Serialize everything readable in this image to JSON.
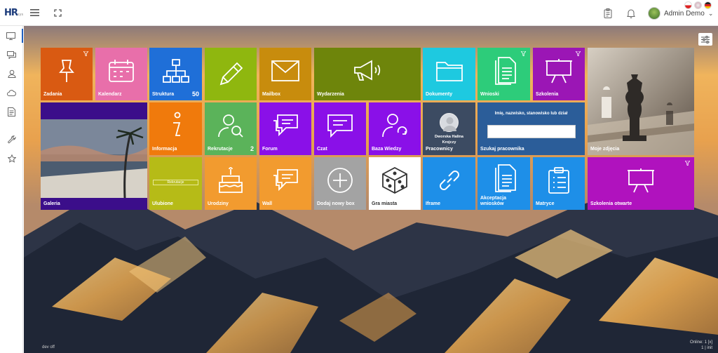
{
  "app": {
    "logo_text": "HR",
    "logo_sub": "sys"
  },
  "header": {
    "user_name": "Admin Demo",
    "user_chevron": "⌄"
  },
  "colors": {
    "accent": "#1f5fbf"
  },
  "sidebar": {
    "items": [
      {
        "icon": "monitor-icon"
      },
      {
        "icon": "chat-icon"
      },
      {
        "icon": "user-icon"
      },
      {
        "icon": "cloud-icon"
      },
      {
        "icon": "document-icon"
      },
      {
        "icon": "wrench-icon"
      },
      {
        "icon": "star-icon"
      }
    ]
  },
  "tiles": {
    "zadania": "Zadania",
    "kalendarz": "Kalendarz",
    "struktura": "Struktura",
    "struktura_count": "50",
    "mailbox": "Mailbox",
    "wydarzenia": "Wydarzenia",
    "dokumenty": "Dokumenty",
    "wnioski": "Wnioski",
    "szkolenia": "Szkolenia",
    "moje_zdjecia": "Moje zdjęcia",
    "galeria": "Galeria",
    "informacja": "Informacja",
    "rekrutacje": "Rekrutacje",
    "rekrutacje_count": "2",
    "forum": "Forum",
    "czat": "Czat",
    "baza_wiedzy": "Baza Wiedzy",
    "pracownicy": "Pracownicy",
    "pracownicy_person": "Dworska Halina Krojczy",
    "szukaj": "Szukaj pracownika",
    "szukaj_hint": "Imię, nazwisko, stanowisko lub dział",
    "ulubione": "Ulubione",
    "ulubione_btn": "Rekrutacje",
    "urodziny": "Urodziny",
    "wall": "Wall",
    "dodaj": "Dodaj nowy box",
    "gra": "Gra miasta",
    "iframe": "Iframe",
    "akceptacja": "Akceptacja wniosków",
    "matryce": "Matryce",
    "szkolenia_otwarte": "Szkolenia otwarte"
  },
  "footer": {
    "left": "dev off",
    "right_1": "Online: 1 [x]",
    "right_2": "1 | init"
  }
}
